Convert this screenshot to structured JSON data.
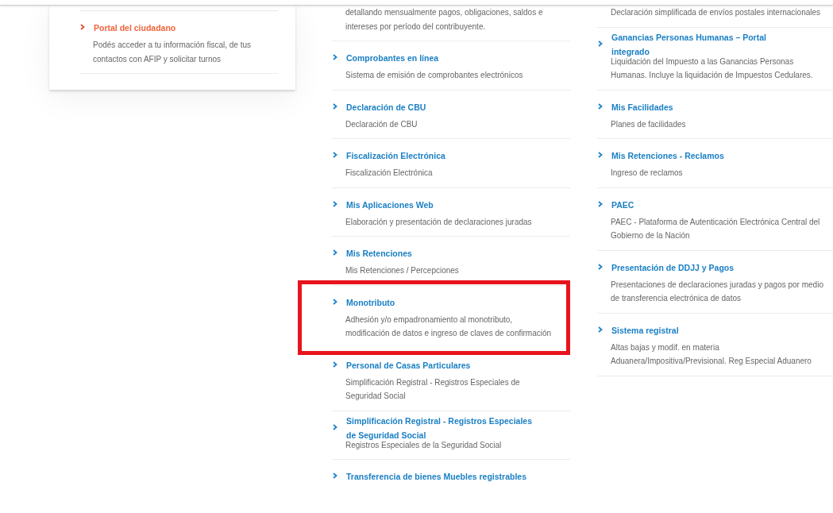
{
  "left_card": {
    "items": [
      {
        "title": "Portal del ciudadano",
        "description": "Podés acceder a tu información fiscal, de tus contactos con AFIP y solicitar turnos",
        "highlighted": false
      }
    ]
  },
  "middle_column": {
    "items": [
      {
        "description": "detallando mensualmente pagos, obligaciones, saldos e intereses por período del contribuyente.",
        "highlighted": false
      },
      {
        "title": "Comprobantes en línea",
        "description": "Sistema de emisión de comprobantes electrónicos",
        "highlighted": false
      },
      {
        "title": "Declaración de CBU",
        "description": "Declaración de CBU",
        "highlighted": false
      },
      {
        "title": "Fiscalización Electrónica",
        "description": "Fiscalización Electrónica",
        "highlighted": false
      },
      {
        "title": "Mis Aplicaciones Web",
        "description": "Elaboración y presentación de declaraciones juradas",
        "highlighted": false
      },
      {
        "title": "Mis Retenciones",
        "description": "Mis Retenciones / Percepciones",
        "highlighted": false
      },
      {
        "title": "Monotributo",
        "description": "Adhesión y/o empadronamiento al monotributo, modificación de datos e ingreso de claves de confirmación",
        "highlighted": true
      },
      {
        "title": "Personal de Casas Particulares",
        "description": "Simplificación Registral - Registros Especiales de Seguridad Social",
        "highlighted": false
      },
      {
        "title": "Simplificación Registral - Registros Especiales de Seguridad Social",
        "description": "Registros Especiales de la Seguridad Social",
        "highlighted": false
      },
      {
        "title": "Transferencia de bienes Muebles registrables",
        "highlighted": false
      }
    ]
  },
  "right_column": {
    "items": [
      {
        "description": "Declaración simplificada de envíos postales internacionales",
        "highlighted": false
      },
      {
        "title": "Ganancias Personas Humanas – Portal integrado",
        "description": "Liquidación del Impuesto a las Ganancias Personas Humanas. Incluye la liquidación de Impuestos Cedulares.",
        "highlighted": false
      },
      {
        "title": "Mis Facilidades",
        "description": "Planes de facilidades",
        "highlighted": false
      },
      {
        "title": "Mis Retenciones - Reclamos",
        "description": "Ingreso de reclamos",
        "highlighted": false
      },
      {
        "title": "PAEC",
        "description": "PAEC - Plataforma de Autenticación Electrónica Central del Gobierno de la Nación",
        "highlighted": false
      },
      {
        "title": "Presentación de DDJJ y Pagos",
        "description": "Presentaciones de declaraciones juradas y pagos por medio de transferencia electrónica de datos",
        "highlighted": false
      },
      {
        "title": "Sistema registral",
        "description": "Altas bajas y modif. en materia Aduanera/Impositiva/Previsional. Reg Especial Aduanero",
        "highlighted": false
      }
    ]
  }
}
